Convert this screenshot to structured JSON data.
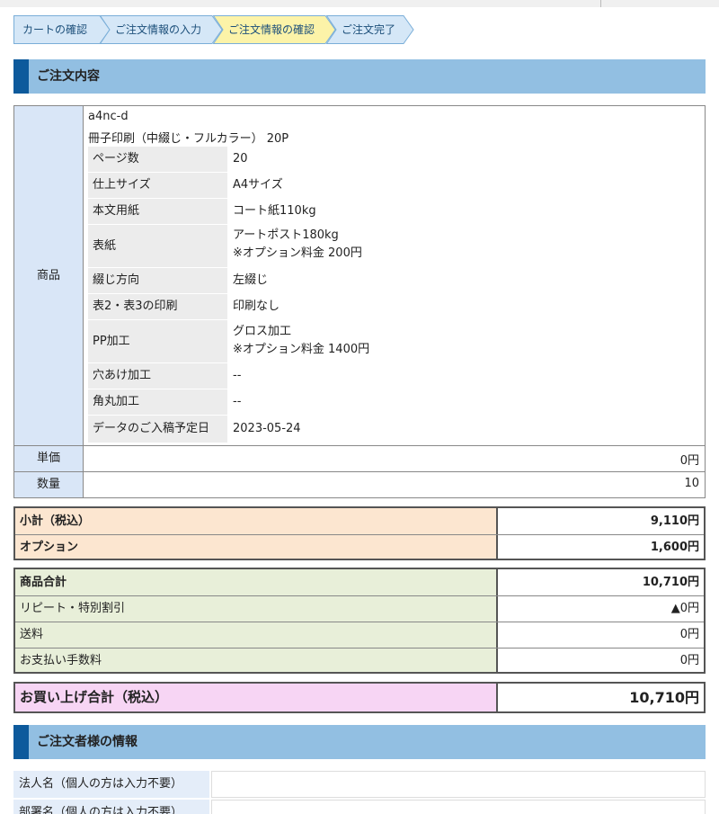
{
  "steps": [
    {
      "label": "カートの確認",
      "active": false
    },
    {
      "label": "ご注文情報の入力",
      "active": false
    },
    {
      "label": "ご注文情報の確認",
      "active": true
    },
    {
      "label": "ご注文完了",
      "active": false
    }
  ],
  "colors": {
    "step_active": "#fcf3a8",
    "step_inactive": "#d5e7f7",
    "step_border": "#7aaed8",
    "section_header": "#92bfe2",
    "section_bar": "#0d5a9c",
    "subtotal_label": "#fce6d0",
    "total_label": "#e8efd9",
    "grand_total_label": "#f7d5f4"
  },
  "order_section": {
    "title": "ご注文内容"
  },
  "product": {
    "label": "商品",
    "code": "a4nc-d",
    "name": "冊子印刷（中綴じ・フルカラー） 20P",
    "specs": [
      {
        "label": "ページ数",
        "value": "20",
        "note": ""
      },
      {
        "label": "仕上サイズ",
        "value": "A4サイズ",
        "note": ""
      },
      {
        "label": "本文用紙",
        "value": "コート紙110kg",
        "note": ""
      },
      {
        "label": "表紙",
        "value": "アートポスト180kg",
        "note": "※オプション料金 200円"
      },
      {
        "label": "綴じ方向",
        "value": "左綴じ",
        "note": ""
      },
      {
        "label": "表2・表3の印刷",
        "value": "印刷なし",
        "note": ""
      },
      {
        "label": "PP加工",
        "value": "グロス加工",
        "note": "※オプション料金 1400円"
      },
      {
        "label": "穴あけ加工",
        "value": "--",
        "note": ""
      },
      {
        "label": "角丸加工",
        "value": "--",
        "note": ""
      },
      {
        "label": "データのご入稿予定日",
        "value": "2023-05-24",
        "note": ""
      }
    ],
    "unit_price_label": "単価",
    "unit_price": "0円",
    "quantity_label": "数量",
    "quantity": "10"
  },
  "subtotals": {
    "subtotal_label": "小計（税込）",
    "subtotal": "9,110円",
    "option_label": "オプション",
    "option": "1,600円"
  },
  "totals": {
    "goods_total_label": "商品合計",
    "goods_total": "10,710円",
    "discount_label": "リピート・特別割引",
    "discount": "▲0円",
    "shipping_label": "送料",
    "shipping": "0円",
    "fee_label": "お支払い手数料",
    "fee": "0円"
  },
  "grand_total": {
    "label": "お買い上げ合計（税込）",
    "value": "10,710円"
  },
  "orderer_section": {
    "title": "ご注文者様の情報",
    "fields": [
      {
        "label": "法人名（個人の方は入力不要）",
        "value": ""
      },
      {
        "label": "部署名（個人の方は入力不要）",
        "value": ""
      }
    ]
  }
}
